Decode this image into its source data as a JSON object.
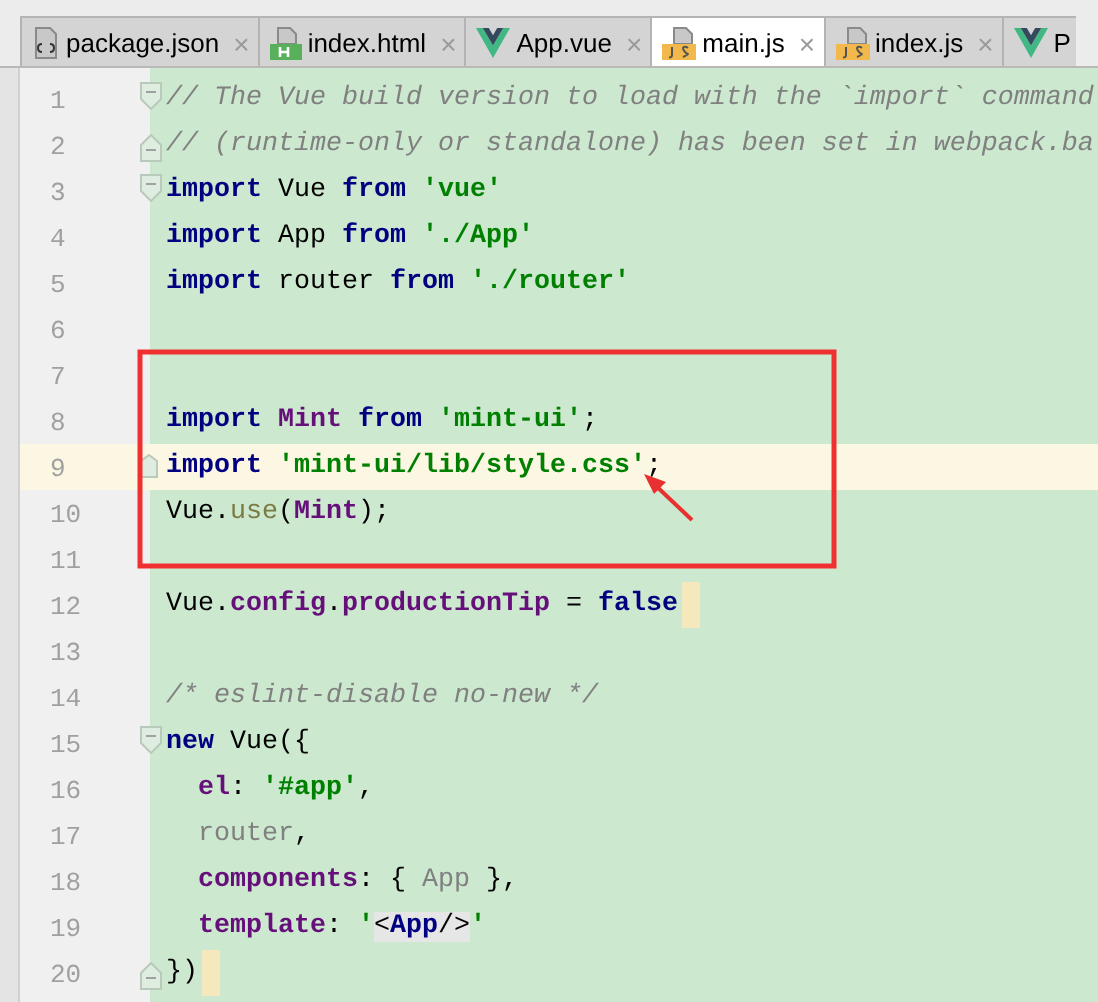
{
  "tabs": [
    {
      "label": "package.json",
      "kind": "json",
      "selected": false,
      "close": "×"
    },
    {
      "label": "index.html",
      "kind": "html",
      "selected": false,
      "close": "×"
    },
    {
      "label": "App.vue",
      "kind": "vue",
      "selected": false,
      "close": "×"
    },
    {
      "label": "main.js",
      "kind": "js",
      "selected": true,
      "close": "×"
    },
    {
      "label": "index.js",
      "kind": "js",
      "selected": false,
      "close": "×"
    },
    {
      "label": "P",
      "kind": "vue",
      "selected": false
    }
  ],
  "lines": [
    {
      "number": "1",
      "kind": "fold-start",
      "current": false,
      "tokens": [
        {
          "kind": "comment",
          "text": "// The Vue build version to load with the `import` command"
        }
      ]
    },
    {
      "number": "2",
      "kind": "fold-end",
      "current": false,
      "tokens": [
        {
          "kind": "comment",
          "text": "// (runtime-only or standalone) has been set in webpack.ba"
        }
      ]
    },
    {
      "number": "3",
      "kind": "fold-start",
      "current": false,
      "tokens": [
        {
          "kind": "keyword",
          "text": "import"
        },
        {
          "kind": "plain",
          "text": " Vue "
        },
        {
          "kind": "keyword",
          "text": "from "
        },
        {
          "kind": "string",
          "text": "'vue'"
        }
      ]
    },
    {
      "number": "4",
      "kind": "plain",
      "current": false,
      "tokens": [
        {
          "kind": "keyword",
          "text": "import"
        },
        {
          "kind": "plain",
          "text": " App "
        },
        {
          "kind": "keyword",
          "text": "from "
        },
        {
          "kind": "string",
          "text": "'./App'"
        }
      ]
    },
    {
      "number": "5",
      "kind": "plain",
      "current": false,
      "tokens": [
        {
          "kind": "keyword",
          "text": "import"
        },
        {
          "kind": "plain",
          "text": " router "
        },
        {
          "kind": "keyword",
          "text": "from "
        },
        {
          "kind": "string",
          "text": "'./router'"
        }
      ]
    },
    {
      "number": "6",
      "kind": "plain",
      "current": false
    },
    {
      "number": "7",
      "kind": "plain",
      "current": false
    },
    {
      "number": "8",
      "kind": "plain",
      "current": false,
      "tokens": [
        {
          "kind": "keyword",
          "text": "import "
        },
        {
          "kind": "member",
          "text": "Mint "
        },
        {
          "kind": "keyword",
          "text": "from "
        },
        {
          "kind": "string",
          "text": "'mint-ui'"
        },
        {
          "kind": "plain",
          "text": ";"
        }
      ]
    },
    {
      "number": "9",
      "kind": "marked",
      "current": true,
      "tokens": [
        {
          "kind": "keyword",
          "text": "import "
        },
        {
          "kind": "string",
          "text": "'mint-ui/lib/style.css'"
        },
        {
          "kind": "plain",
          "text": ";"
        }
      ]
    },
    {
      "number": "10",
      "kind": "plain",
      "current": false,
      "tokens": [
        {
          "kind": "plain",
          "text": "Vue."
        },
        {
          "kind": "function",
          "text": "use"
        },
        {
          "kind": "plain",
          "text": "("
        },
        {
          "kind": "member",
          "text": "Mint"
        },
        {
          "kind": "plain",
          "text": ");"
        }
      ]
    },
    {
      "number": "11",
      "kind": "plain",
      "current": false
    },
    {
      "number": "12",
      "kind": "plain",
      "current": false,
      "brace_mark": true,
      "tokens": [
        {
          "kind": "plain",
          "text": "Vue."
        },
        {
          "kind": "member",
          "text": "config"
        },
        {
          "kind": "plain",
          "text": "."
        },
        {
          "kind": "member",
          "text": "productionTip"
        },
        {
          "kind": "plain",
          "text": " = "
        },
        {
          "kind": "keyword",
          "text": "false"
        }
      ]
    },
    {
      "number": "13",
      "kind": "plain",
      "current": false
    },
    {
      "number": "14",
      "kind": "plain",
      "current": false,
      "tokens": [
        {
          "kind": "comment",
          "text": "/* eslint-disable no-new */"
        }
      ]
    },
    {
      "number": "15",
      "kind": "fold-start",
      "current": false,
      "tokens": [
        {
          "kind": "keyword",
          "text": "new"
        },
        {
          "kind": "plain",
          "text": " Vue({"
        }
      ]
    },
    {
      "number": "16",
      "kind": "plain",
      "current": false,
      "tokens": [
        {
          "kind": "member",
          "text": "  el"
        },
        {
          "kind": "plain",
          "text": ": "
        },
        {
          "kind": "string",
          "text": "'#app'"
        },
        {
          "kind": "plain",
          "text": ","
        }
      ]
    },
    {
      "number": "17",
      "kind": "plain",
      "current": false,
      "tokens": [
        {
          "kind": "unused",
          "text": "  router"
        },
        {
          "kind": "plain",
          "text": ","
        }
      ]
    },
    {
      "number": "18",
      "kind": "plain",
      "current": false,
      "tokens": [
        {
          "kind": "member",
          "text": "  components"
        },
        {
          "kind": "plain",
          "text": ": { "
        },
        {
          "kind": "unused",
          "text": "App"
        },
        {
          "kind": "plain",
          "text": " },"
        }
      ]
    },
    {
      "number": "19",
      "kind": "plain",
      "current": false,
      "tokens": [
        {
          "kind": "member",
          "text": "  template"
        },
        {
          "kind": "plain",
          "text": ": "
        },
        {
          "kind": "string",
          "text": "'"
        },
        {
          "kind": "tag-open",
          "text": "<"
        },
        {
          "kind": "tag-name",
          "text": "App"
        },
        {
          "kind": "tag-close",
          "text": "/>"
        },
        {
          "kind": "string",
          "text": "'"
        }
      ]
    },
    {
      "number": "20",
      "kind": "fold-end",
      "current": false,
      "brace_mark": true,
      "tokens": [
        {
          "kind": "plain",
          "text": "})"
        }
      ]
    }
  ]
}
